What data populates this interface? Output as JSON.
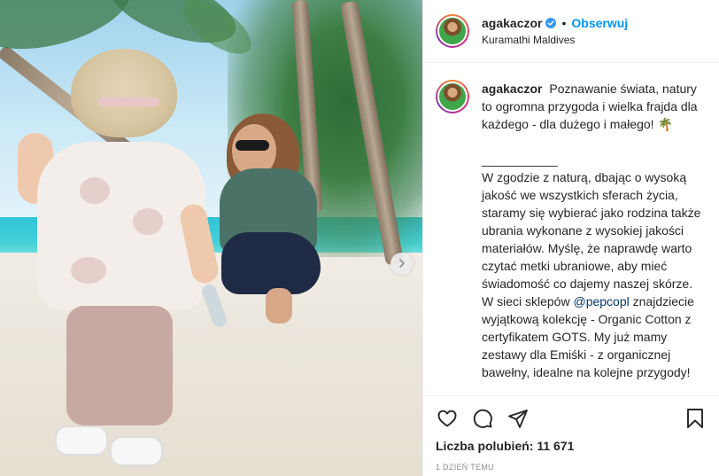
{
  "post": {
    "author": {
      "username": "agakaczor",
      "verified": true,
      "follow_label": "Obserwuj",
      "separator": "•",
      "location": "Kuramathi Maldives"
    },
    "caption": {
      "username": "agakaczor",
      "paragraph1": "Poznawanie świata, natury to ogromna przygoda i wielka frajda dla każdego - dla dużego i małego! 🌴",
      "divider": "___________",
      "paragraph2_before_mention": "W zgodzie z naturą, dbając o wysoką jakość we wszystkich sferach życia, staramy się wybierać jako rodzina także ubrania wykonane z wysokiej jakości materiałów. Myślę, że naprawdę warto czytać metki ubraniowe, aby mieć świadomość co dajemy naszej skórze. W sieci sklepów",
      "mention": "@pepcopl",
      "paragraph2_after_mention": "znajdziecie wyjątkową kolekcję - Organic Cotton z certyfikatem GOTS. My już mamy zestawy dla Emiśki - z organicznej bawełny, idealne na kolejne przygody!"
    },
    "actions": {
      "like_icon": "heart-icon",
      "comment_icon": "comment-icon",
      "share_icon": "paper-plane-icon",
      "save_icon": "bookmark-icon"
    },
    "likes_label": "Liczba polubień: 11 671",
    "timestamp": "1 dzień temu",
    "media": {
      "next_icon": "chevron-right-icon"
    },
    "colors": {
      "link_blue": "#0095f6",
      "mention_blue": "#00376b",
      "text": "#262626",
      "muted": "#8e8e8e",
      "border": "#efefef"
    }
  }
}
